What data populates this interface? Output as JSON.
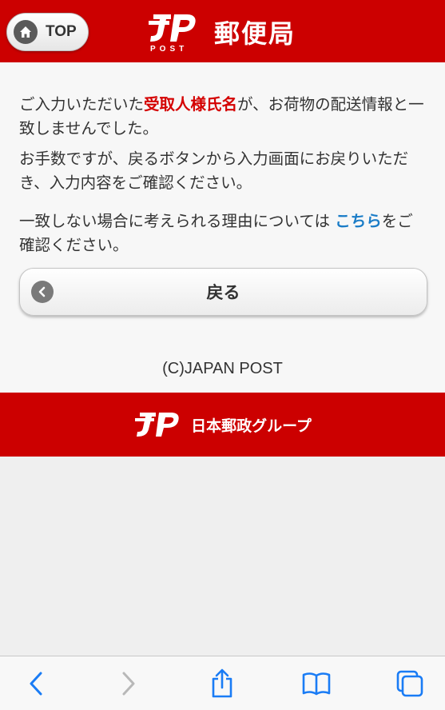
{
  "header": {
    "top_label": "TOP",
    "brand_post": "POST",
    "brand_title": "郵便局"
  },
  "message": {
    "p1_pre": "ご入力いただいた",
    "p1_highlight": "受取人様氏名",
    "p1_post": "が、お荷物の配送情報と一致しませんでした。",
    "p2": "お手数ですが、戻るボタンから入力画面にお戻りいただき、入力内容をご確認ください。",
    "p3_pre": "一致しない場合に考えられる理由については ",
    "p3_link": "こちら",
    "p3_post": "をご確認ください。"
  },
  "back_button": {
    "label": "戻る"
  },
  "copyright": "(C)JAPAN POST",
  "footer": {
    "group_name": "日本郵政グループ"
  },
  "colors": {
    "brand_red": "#cc0000",
    "highlight_red": "#d40000",
    "link_blue": "#1a7cc7",
    "toolbar_blue": "#1a7cf5"
  },
  "toolbar": {
    "icons": [
      "back-icon",
      "forward-icon",
      "share-icon",
      "bookmarks-icon",
      "tabs-icon"
    ]
  }
}
